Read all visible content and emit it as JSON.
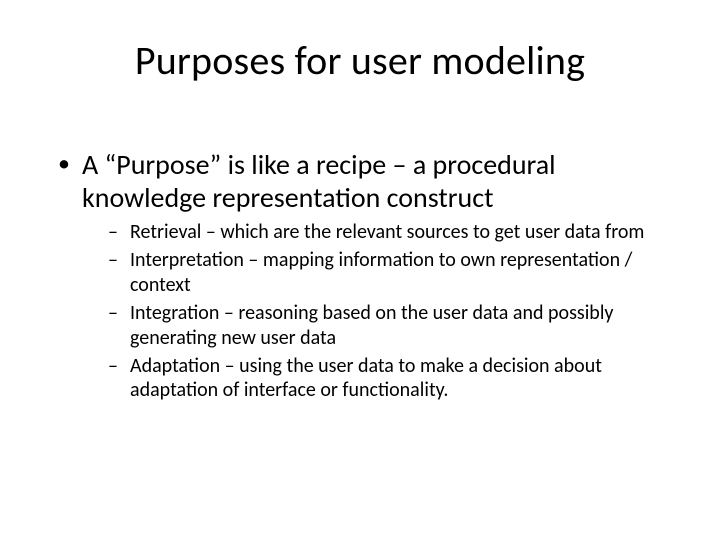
{
  "slide": {
    "title": "Purposes for user modeling",
    "bullets": [
      {
        "text": "A “Purpose” is like a recipe – a procedural knowledge representation construct",
        "sub": [
          "Retrieval – which are the relevant sources to get user data from",
          "Interpretation – mapping information to own representation / context",
          "Integration – reasoning based on the user data and possibly generating new user data",
          "Adaptation – using the user data to make a decision about adaptation of interface or functionality."
        ]
      }
    ]
  }
}
